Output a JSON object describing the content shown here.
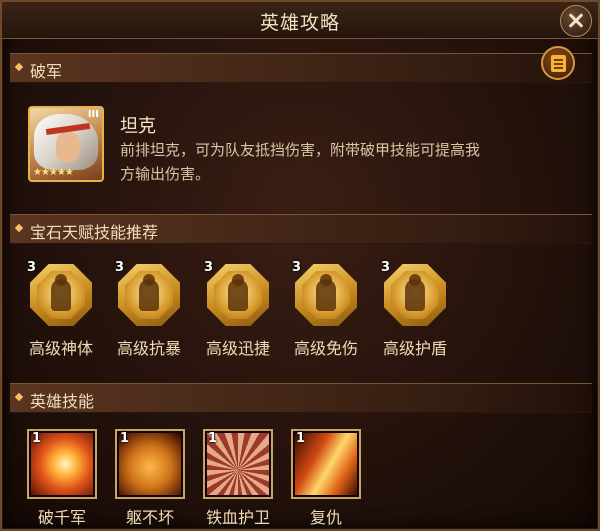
{
  "window": {
    "title": "英雄攻略"
  },
  "sections": {
    "hero": "破军",
    "gems": "宝石天赋技能推荐",
    "skills": "英雄技能"
  },
  "hero": {
    "role": "坦克",
    "desc_line1": "前排坦克，可为队友抵挡伤害，附带破甲技能可提高我",
    "desc_line2": "方输出伤害。",
    "stars": "★★★★★",
    "rank": "III"
  },
  "gems": [
    {
      "level": "3",
      "name": "高级神体",
      "icon": "body-silhouette-icon"
    },
    {
      "level": "3",
      "name": "高级抗暴",
      "icon": "burst-figure-icon"
    },
    {
      "level": "3",
      "name": "高级迅捷",
      "icon": "running-figure-icon"
    },
    {
      "level": "3",
      "name": "高级免伤",
      "icon": "shield-figure-icon"
    },
    {
      "level": "3",
      "name": "高级护盾",
      "icon": "crest-shield-icon"
    }
  ],
  "skills": [
    {
      "level": "1",
      "name": "破千军",
      "icon": "slash-burst-icon"
    },
    {
      "level": "1",
      "name": "躯不坏",
      "icon": "hex-shell-icon"
    },
    {
      "level": "1",
      "name": "铁血护卫",
      "icon": "guardian-icon"
    },
    {
      "level": "1",
      "name": "复仇",
      "icon": "fire-streak-icon"
    }
  ],
  "colors": {
    "accent_gold": "#f3c35b",
    "panel_bg": "#24120c",
    "text": "#efdcb6"
  }
}
